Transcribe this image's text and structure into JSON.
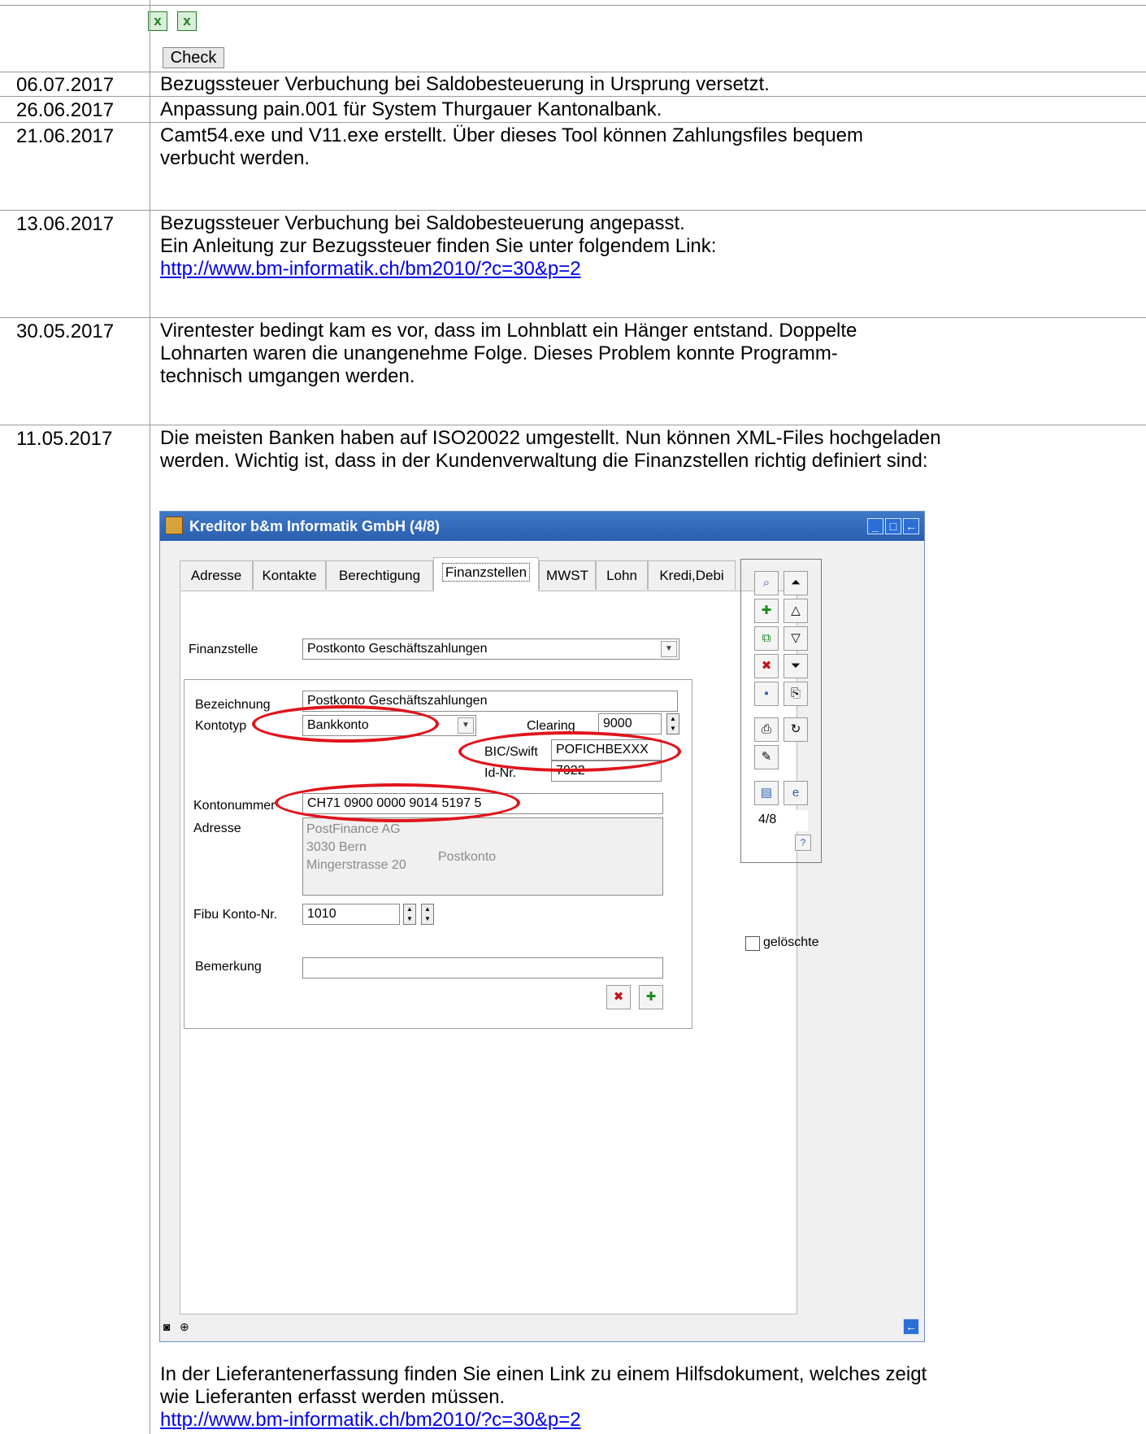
{
  "toolbar": {
    "check_label": "Check"
  },
  "entries": [
    {
      "date": "06.07.2017",
      "lines": [
        "Bezugssteuer Verbuchung bei Saldobesteuerung in Ursprung versetzt."
      ]
    },
    {
      "date": "26.06.2017",
      "lines": [
        "Anpassung pain.001 für System Thurgauer Kantonalbank."
      ]
    },
    {
      "date": "21.06.2017",
      "lines": [
        "Camt54.exe und V11.exe erstellt. Über dieses Tool können Zahlungsfiles bequem",
        "verbucht werden."
      ]
    },
    {
      "date": "13.06.2017",
      "lines": [
        "Bezugssteuer Verbuchung bei Saldobesteuerung angepasst.",
        "Ein Anleitung zur Bezugssteuer finden Sie unter folgendem Link:"
      ],
      "link": "http://www.bm-informatik.ch/bm2010/?c=30&p=2"
    },
    {
      "date": "30.05.2017",
      "lines": [
        "Virentester bedingt kam es vor, dass im Lohnblatt ein Hänger entstand. Doppelte",
        "Lohnarten waren die unangenehme Folge. Dieses Problem konnte Programm-",
        "technisch umgangen werden."
      ]
    },
    {
      "date": "11.05.2017",
      "lines": [
        "Die meisten Banken haben auf ISO20022 umgestellt. Nun können XML-Files hochgeladen",
        "werden. Wichtig ist, dass in der Kundenverwaltung die Finanzstellen richtig definiert sind:"
      ],
      "after_lines": [
        "In der Lieferantenerfassung finden Sie einen Link zu einem Hilfsdokument, welches zeigt",
        "wie Lieferanten erfasst werden müssen."
      ],
      "after_link": "http://www.bm-informatik.ch/bm2010/?c=30&p=2"
    }
  ],
  "window": {
    "title": "Kreditor b&m Informatik GmbH (4/8)",
    "tabs": [
      "Adresse",
      "Kontakte",
      "Berechtigung",
      "Finanzstellen",
      "MWST",
      "Lohn",
      "Kredi,Debi"
    ],
    "active_tab": "Finanzstellen",
    "finanzstelle_label": "Finanzstelle",
    "finanzstelle_value": "Postkonto Geschäftszahlungen",
    "bezeichnung_label": "Bezeichnung",
    "bezeichnung_value": "Postkonto Geschäftszahlungen",
    "kontotyp_label": "Kontotyp",
    "kontotyp_value": "Bankkonto",
    "clearing_label": "Clearing",
    "clearing_value": "9000",
    "bic_label": "BIC/Swift",
    "bic_value": "POFICHBEXXX",
    "idnr_label": "Id-Nr.",
    "idnr_value": "7022",
    "kontonummer_label": "Kontonummer",
    "kontonummer_value": "CH71 0900 0000 9014 5197 5",
    "adresse_label": "Adresse",
    "adresse_lines": [
      "PostFinance AG",
      "3030 Bern",
      "Mingerstrasse 20"
    ],
    "adresse_note": "Postkonto",
    "fibu_label": "Fibu Konto-Nr.",
    "fibu_value": "1010",
    "bemerkung_label": "Bemerkung",
    "bemerkung_value": "",
    "record_counter": "4/8",
    "help_label": "?",
    "deleted_label": "gelöschte",
    "accent_color": "#2a5fae",
    "highlight_color": "#e0141b"
  }
}
